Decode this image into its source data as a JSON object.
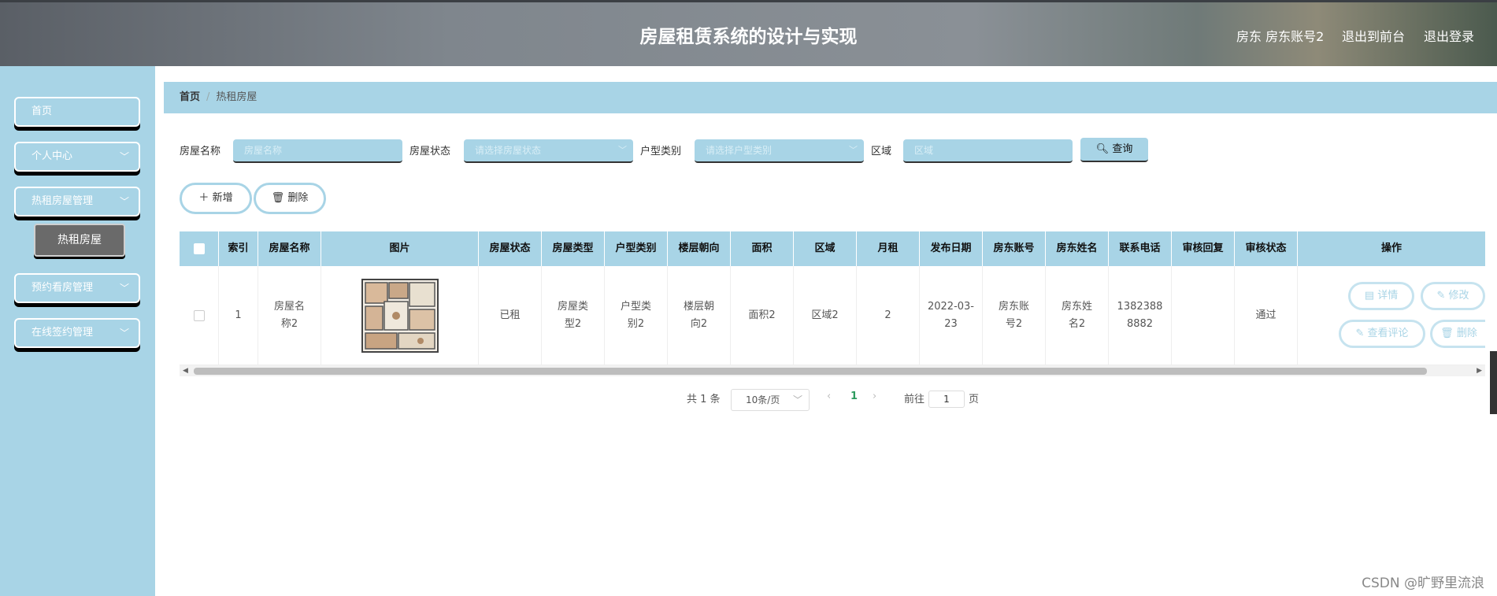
{
  "header": {
    "title": "房屋租赁系统的设计与实现",
    "user": "房东 房东账号2",
    "to_front": "退出到前台",
    "logout": "退出登录"
  },
  "sidebar": {
    "items": [
      {
        "label": "首页"
      },
      {
        "label": "个人中心"
      },
      {
        "label": "热租房屋管理"
      },
      {
        "label": "预约看房管理"
      },
      {
        "label": "在线签约管理"
      }
    ],
    "sub_item": "热租房屋"
  },
  "breadcrumb": {
    "home": "首页",
    "sep": "/",
    "current": "热租房屋"
  },
  "search": {
    "name_label": "房屋名称",
    "name_placeholder": "房屋名称",
    "status_label": "房屋状态",
    "status_placeholder": "请选择房屋状态",
    "type_label": "户型类别",
    "type_placeholder": "请选择户型类别",
    "area_label": "区域",
    "area_placeholder": "区域",
    "query": "查询"
  },
  "actions": {
    "add": "新增",
    "delete": "删除"
  },
  "table": {
    "headers": [
      "索引",
      "房屋名称",
      "图片",
      "房屋状态",
      "房屋类型",
      "户型类别",
      "楼层朝向",
      "面积",
      "区域",
      "月租",
      "发布日期",
      "房东账号",
      "房东姓名",
      "联系电话",
      "审核回复",
      "审核状态",
      "操作"
    ],
    "rows": [
      {
        "index": "1",
        "name": "房屋名称2",
        "status": "已租",
        "house_type": "房屋类型2",
        "layout": "户型类别2",
        "floor": "楼层朝向2",
        "area": "面积2",
        "region": "区域2",
        "rent": "2",
        "date": "2022-03-23",
        "owner_account": "房东账号2",
        "owner_name": "房东姓名2",
        "phone": "13823888882",
        "reply": "",
        "audit": "通过"
      }
    ],
    "ops": {
      "detail": "详情",
      "edit": "修改",
      "comments": "查看评论",
      "delete": "删除"
    }
  },
  "pager": {
    "total": "共 1 条",
    "size": "10条/页",
    "current": "1",
    "goto": "前往",
    "page_value": "1",
    "page_unit": "页"
  },
  "watermark": "CSDN @旷野里流浪",
  "colors": {
    "accent": "#a8d4e6"
  }
}
